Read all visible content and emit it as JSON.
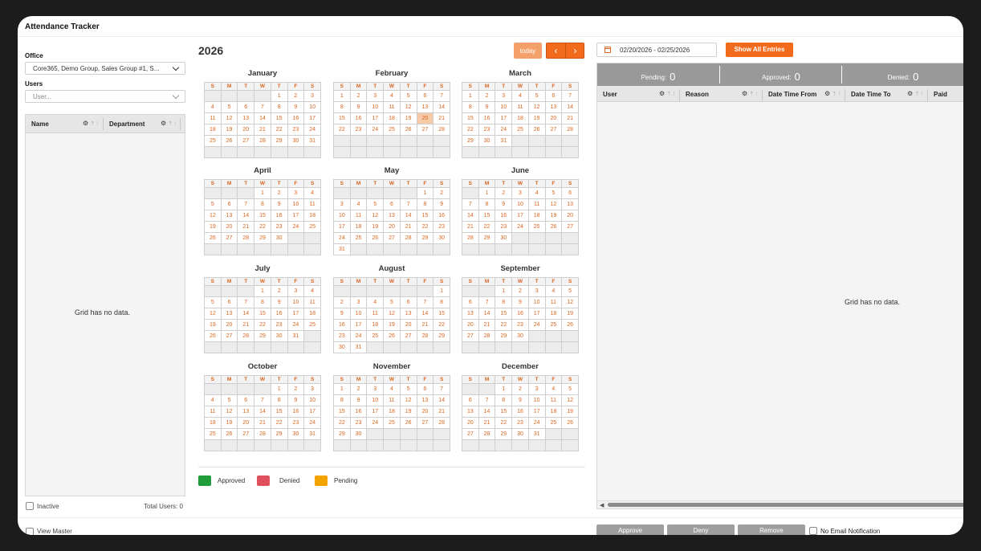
{
  "app": {
    "title": "Attendance Tracker"
  },
  "filters": {
    "office_label": "Office",
    "office_value": "Core365, Demo Group, Sales Group #1, S...",
    "users_label": "Users",
    "users_placeholder": "User..."
  },
  "users_grid": {
    "columns": [
      "Name",
      "Department"
    ],
    "empty_text": "Grid has no data.",
    "inactive_label": "Inactive",
    "total_users": "Total Users: 0",
    "view_master_label": "View Master"
  },
  "calendar": {
    "year": "2026",
    "today_label": "today",
    "prev_icon": "chevron-left-icon",
    "next_icon": "chevron-right-icon",
    "weekday_headers": [
      "S",
      "M",
      "T",
      "W",
      "T",
      "F",
      "S"
    ],
    "highlighted_date": "2026-02-20",
    "months": [
      {
        "name": "January",
        "first_weekday": 4,
        "days": 31
      },
      {
        "name": "February",
        "first_weekday": 0,
        "days": 28
      },
      {
        "name": "March",
        "first_weekday": 0,
        "days": 31
      },
      {
        "name": "April",
        "first_weekday": 3,
        "days": 30
      },
      {
        "name": "May",
        "first_weekday": 5,
        "days": 31
      },
      {
        "name": "June",
        "first_weekday": 1,
        "days": 30
      },
      {
        "name": "July",
        "first_weekday": 3,
        "days": 31
      },
      {
        "name": "August",
        "first_weekday": 6,
        "days": 31
      },
      {
        "name": "September",
        "first_weekday": 2,
        "days": 30
      },
      {
        "name": "October",
        "first_weekday": 4,
        "days": 31
      },
      {
        "name": "November",
        "first_weekday": 0,
        "days": 30
      },
      {
        "name": "December",
        "first_weekday": 2,
        "days": 31
      }
    ],
    "legend": [
      {
        "label": "Approved",
        "color": "#1f9d3a"
      },
      {
        "label": "Denied",
        "color": "#e0505c"
      },
      {
        "label": "Pending",
        "color": "#f5a300"
      }
    ]
  },
  "entries": {
    "date_range": "02/20/2026 - 02/25/2026",
    "show_all_label": "Show All Entries",
    "stats": [
      {
        "label": "Pending:",
        "count": "0"
      },
      {
        "label": "Approved:",
        "count": "0"
      },
      {
        "label": "Denied:",
        "count": "0"
      }
    ],
    "columns": [
      "User",
      "Reason",
      "Date Time From",
      "Date Time To",
      "Paid"
    ],
    "empty_text": "Grid has no data.",
    "actions": {
      "approve": "Approve",
      "deny": "Deny",
      "remove": "Remove",
      "no_email": "No Email Notification"
    }
  },
  "colors": {
    "accent": "#f26b1d",
    "accent_light": "#f4a06b",
    "day_text": "#d9661e",
    "highlight": "#f6c9a7",
    "stat_bar": "#999999"
  }
}
